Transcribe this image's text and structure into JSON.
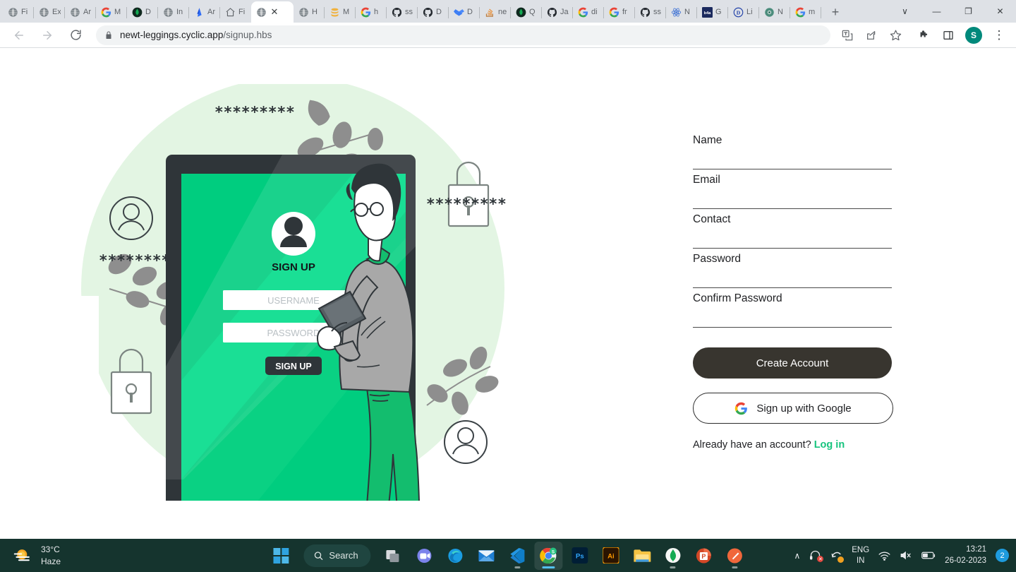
{
  "browser": {
    "tabs": [
      {
        "title": "Fi",
        "icon": "globe-icon",
        "active": false
      },
      {
        "title": "Ex",
        "icon": "globe-icon",
        "active": false
      },
      {
        "title": "Ar",
        "icon": "globe-icon",
        "active": false
      },
      {
        "title": "M",
        "icon": "google-icon",
        "active": false
      },
      {
        "title": "D",
        "icon": "mongodb-icon",
        "active": false
      },
      {
        "title": "In",
        "icon": "globe-icon",
        "active": false
      },
      {
        "title": "Ar",
        "icon": "azure-icon",
        "active": false
      },
      {
        "title": "Fi",
        "icon": "home-icon",
        "active": false
      },
      {
        "title": "",
        "icon": "globe-icon",
        "active": true
      },
      {
        "title": "H",
        "icon": "globe-icon",
        "active": false
      },
      {
        "title": "M",
        "icon": "database-icon",
        "active": false
      },
      {
        "title": "h",
        "icon": "google-icon",
        "active": false
      },
      {
        "title": "ss",
        "icon": "github-icon",
        "active": false
      },
      {
        "title": "D",
        "icon": "github-icon",
        "active": false
      },
      {
        "title": "D",
        "icon": "dropbox-icon",
        "active": false
      },
      {
        "title": "ne",
        "icon": "stackoverflow-icon",
        "active": false
      },
      {
        "title": "Q",
        "icon": "mongodb-icon",
        "active": false
      },
      {
        "title": "Ja",
        "icon": "github-icon",
        "active": false
      },
      {
        "title": "di",
        "icon": "google-icon",
        "active": false
      },
      {
        "title": "fr",
        "icon": "google-icon",
        "active": false
      },
      {
        "title": "ss",
        "icon": "github-icon",
        "active": false
      },
      {
        "title": "N",
        "icon": "react-icon",
        "active": false
      },
      {
        "title": "G",
        "icon": "b4a-icon",
        "active": false
      },
      {
        "title": "Li",
        "icon": "d-circle-icon",
        "active": false
      },
      {
        "title": "N",
        "icon": "chrome-icon",
        "active": false
      },
      {
        "title": "m",
        "icon": "google-icon",
        "active": false
      }
    ],
    "new_tab_label": "+",
    "window_controls": {
      "tab_search": "∨",
      "minimize": "—",
      "maximize": "❐",
      "close": "✕"
    },
    "toolbar": {
      "back": "←",
      "forward": "→",
      "reload": "⟳",
      "lock_icon": "lock-icon",
      "url_domain": "newt-leggings.cyclic.app",
      "url_path": "/signup.hbs",
      "translate_icon": "translate-icon",
      "share_icon": "share-icon",
      "bookmark_icon": "star-icon",
      "extensions_icon": "puzzle-icon",
      "panel_icon": "side-panel-icon",
      "profile_initial": "S",
      "menu_icon": "three-dot-menu-icon"
    }
  },
  "page": {
    "illustration": {
      "card_title": "SIGN UP",
      "username_placeholder": "USERNAME",
      "password_placeholder": "PASSWORD",
      "button_label": "SIGN UP",
      "masked_text": "*********",
      "masked_text_long": "**********",
      "colors": {
        "green": "#00cd7f",
        "green_light": "#00e08c",
        "pale_green": "#e3f5e3",
        "dark": "#2f3539",
        "gray": "#8e8e8e"
      }
    },
    "form": {
      "fields": [
        {
          "name": "name",
          "placeholder": "Name",
          "value": "",
          "type": "text"
        },
        {
          "name": "email",
          "placeholder": "Email",
          "value": "",
          "type": "text"
        },
        {
          "name": "contact",
          "placeholder": "Contact",
          "value": "",
          "type": "text"
        },
        {
          "name": "password",
          "placeholder": "Password",
          "value": "",
          "type": "password"
        },
        {
          "name": "confirm_password",
          "placeholder": "Confirm Password",
          "value": "",
          "type": "password"
        }
      ],
      "create_account_label": "Create Account",
      "google_signup_label": "Sign up with Google",
      "already_text": "Already have an account?",
      "login_link": "Log in",
      "link_color": "#16c47e",
      "primary_button_color": "#38352f"
    }
  },
  "taskbar": {
    "weather": {
      "temperature": "33°C",
      "condition": "Haze",
      "icon": "haze-sun-icon"
    },
    "start_icon": "windows-start-icon",
    "search_label": "Search",
    "search_icon": "search-icon",
    "apps": [
      {
        "name": "task-view-icon",
        "glyph": "❑",
        "indicator": "none"
      },
      {
        "name": "teams-icon",
        "glyph": "◑",
        "indicator": "none"
      },
      {
        "name": "edge-icon",
        "glyph": "◎",
        "indicator": "none"
      },
      {
        "name": "mail-icon",
        "glyph": "✉",
        "indicator": "none"
      },
      {
        "name": "vscode-icon",
        "glyph": "✕",
        "indicator": "small"
      },
      {
        "name": "chrome-icon",
        "glyph": "◉",
        "indicator": "wide"
      },
      {
        "name": "photoshop-icon",
        "glyph": "Ps",
        "indicator": "none"
      },
      {
        "name": "illustrator-icon",
        "glyph": "Ai",
        "indicator": "none"
      },
      {
        "name": "file-explorer-icon",
        "glyph": "▰",
        "indicator": "none"
      },
      {
        "name": "mongodb-compass-icon",
        "glyph": "●",
        "indicator": "small"
      },
      {
        "name": "powerpoint-icon",
        "glyph": "P",
        "indicator": "none"
      },
      {
        "name": "postman-icon",
        "glyph": "∕",
        "indicator": "small"
      }
    ],
    "tray": {
      "chevron": "∧",
      "headset_icon": "headset-muted-icon",
      "sync_icon": "sync-warning-icon",
      "language": "ENG",
      "region": "IN",
      "wifi_icon": "wifi-icon",
      "volume_icon": "volume-muted-icon",
      "battery_icon": "battery-icon",
      "time": "13:21",
      "date": "26-02-2023",
      "notification_count": "2"
    }
  }
}
